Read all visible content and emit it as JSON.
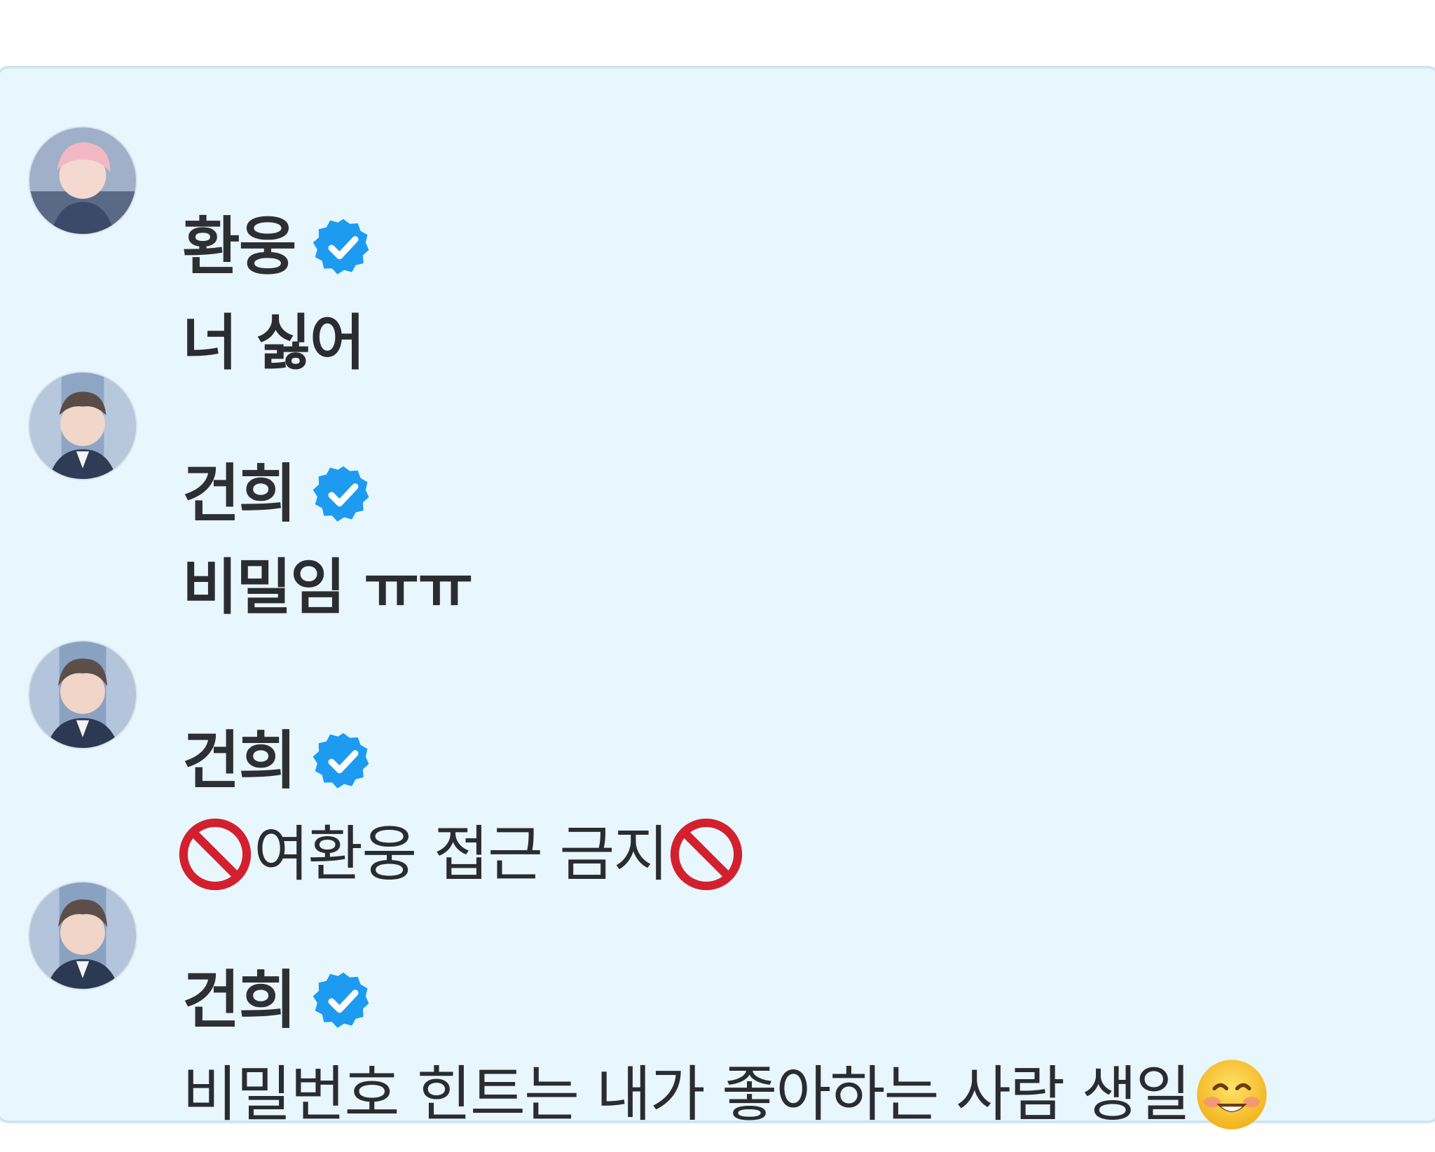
{
  "colors": {
    "panel_background": "#e8f6fe",
    "panel_border": "#cfe6f1",
    "verified_badge": "#1d9bf0",
    "text": "#2e2f33"
  },
  "comments": [
    {
      "author": "환웅",
      "verified": true,
      "avatar_icon": "avatar-hwanwoong",
      "text": "너 싫어"
    },
    {
      "author": "건희",
      "verified": true,
      "avatar_icon": "avatar-geonhee",
      "text": "비밀임 ㅠㅠ"
    },
    {
      "author": "건희",
      "verified": true,
      "avatar_icon": "avatar-geonhee",
      "text_prefix_icon": "prohibited-emoji",
      "text": "여환웅 접근 금지",
      "text_suffix_icon": "prohibited-emoji"
    },
    {
      "author": "건희",
      "verified": true,
      "avatar_icon": "avatar-geonhee",
      "text": "비밀번호 힌트는 내가 좋아하는 사람 생일",
      "text_suffix_icon": "smiling-face-emoji"
    }
  ]
}
